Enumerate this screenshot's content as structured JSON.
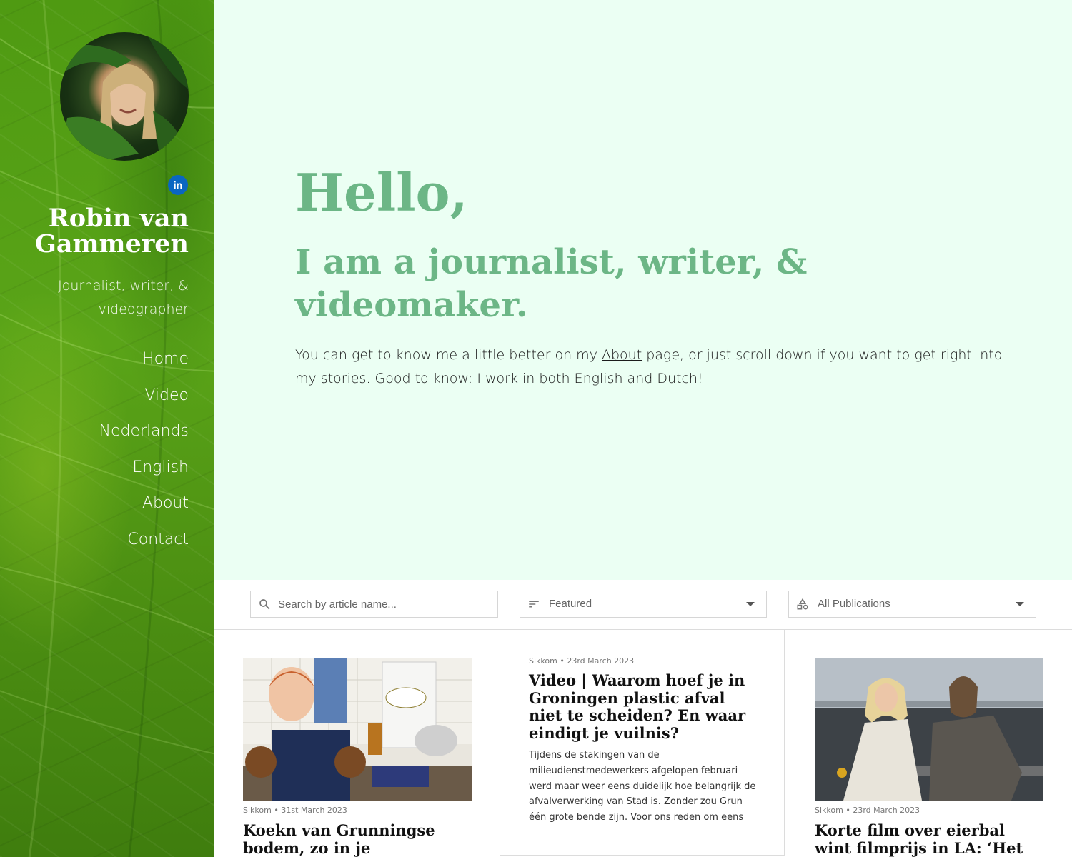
{
  "sidebar": {
    "name": "Robin van Gammeren",
    "tagline": "Journalist, writer, & videographer",
    "linkedin_label": "in",
    "nav": [
      {
        "label": "Home"
      },
      {
        "label": "Video"
      },
      {
        "label": "Nederlands"
      },
      {
        "label": "English"
      },
      {
        "label": "About"
      },
      {
        "label": "Contact"
      }
    ]
  },
  "hero": {
    "greeting": "Hello,",
    "headline": "I am a journalist, writer, & videomaker.",
    "intro_before": "You can get to know me a little better on my ",
    "intro_link": "About",
    "intro_after": " page, or just scroll down if you want to get right into my stories. Good to know: I work in both English and Dutch!"
  },
  "filters": {
    "search_placeholder": "Search by article name...",
    "sort_value": "Featured",
    "publication_value": "All Publications"
  },
  "articles": [
    {
      "publication": "Sikkom",
      "date": "31st March 2023",
      "title": "Koekn van Grunningse bodem, zo in je brievenbus:"
    },
    {
      "publication": "Sikkom",
      "date": "23rd March 2023",
      "title": "Video | Waarom hoef je in Groningen plastic afval niet te scheiden? En waar eindigt je vuilnis?",
      "excerpt": "Tijdens de stakingen van de milieudienstmedewerkers afgelopen februari werd maar weer eens duidelijk hoe belangrijk de afvalverwerking van Stad is. Zonder zou Grun één grote bende zijn. Voor ons reden om eens een dagj..."
    },
    {
      "publication": "Sikkom",
      "date": "23rd March 2023",
      "title": "Korte film over eierbal wint filmprijs in LA: ‘Het werd"
    }
  ],
  "meta_separator": "•",
  "colors": {
    "hero_bg": "#ebfff3",
    "accent_green": "#6cb686",
    "sidebar_green": "#4f9a12",
    "linkedin_blue": "#0a66c2"
  }
}
